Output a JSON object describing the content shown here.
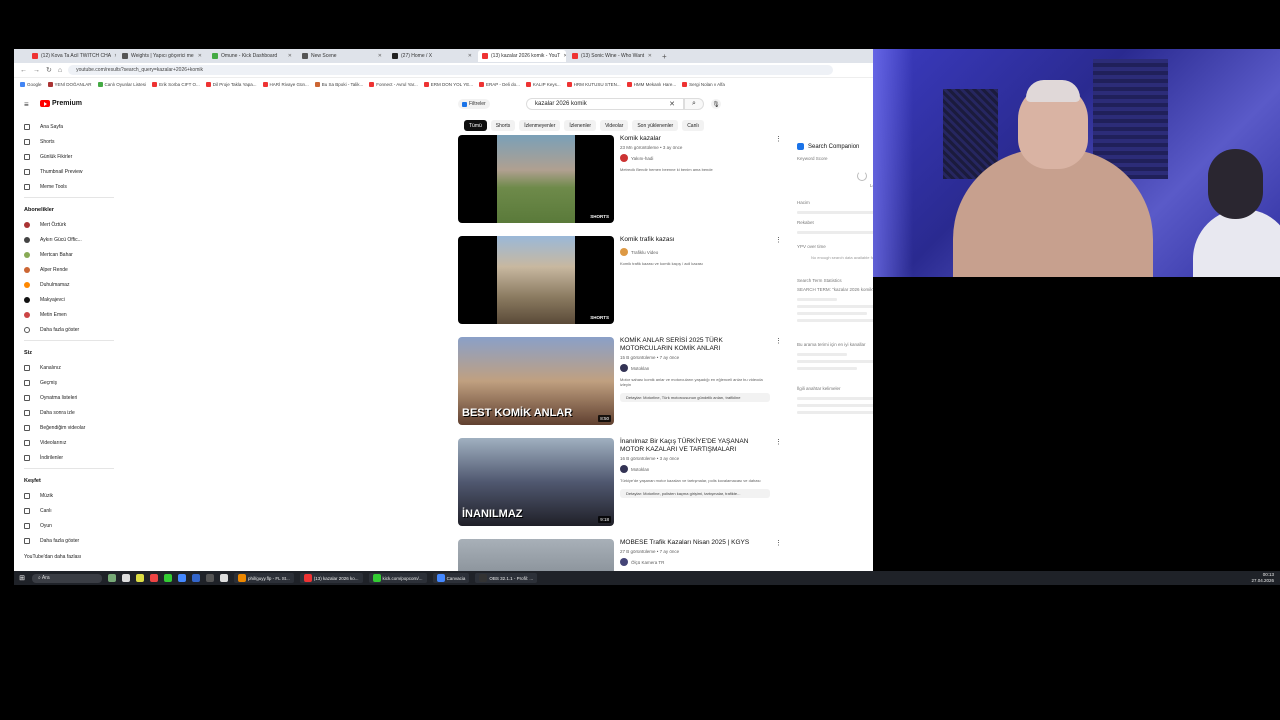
{
  "browser": {
    "tabs": [
      {
        "label": "(12) Kova Ta Acil TWITCH CHA",
        "color": "#e33"
      },
      {
        "label": "Weights | Yapıcı göçerici me",
        "color": "#555"
      },
      {
        "label": "Omune - Kick Dashboard",
        "color": "#4a4"
      },
      {
        "label": "New Scene",
        "color": "#555"
      },
      {
        "label": "(27) Home / X",
        "color": "#222"
      },
      {
        "label": "(13) kazalar 2026 komik - YouT",
        "color": "#e33",
        "active": true
      },
      {
        "label": "(13) Sonic Wine - Who Want",
        "color": "#e33"
      }
    ],
    "url": "youtube.com/results?search_query=kazalar+2026+komik",
    "bookmarks": [
      "Google",
      "YENİ DOĞANLAR",
      "Canlı Oyunlar Listesi",
      "Erik Sorba CIFT O...",
      "Dil Proje Takla Yapa...",
      "HARİ Rivaye Gün...",
      "Bu Sa Bpoki - Talik...",
      "Fonnect - Avrul Yar...",
      "ERM DON YOL YE...",
      "ERAP - Deli do...",
      "KALIP Keys...",
      "HRM KUTUSU STEN...",
      "HMM Mekanlı Hare...",
      "Sergi Nolan v Alfa"
    ]
  },
  "youtube": {
    "logo": "Premium",
    "filters_label": "Filtreler",
    "search_query": "kazalar 2026 komik",
    "sidebar": {
      "main": [
        "Ana Sayfa",
        "Shorts",
        "Günlük Fikirler",
        "Thumbnail Preview",
        "Meme Tools"
      ],
      "subs_heading": "Abonelikler",
      "subs": [
        {
          "name": "Mert Öztürk",
          "color": "#a33"
        },
        {
          "name": "Aykırı Gücü Offic...",
          "color": "#444"
        },
        {
          "name": "Mertcan Bahar",
          "color": "#8a5"
        },
        {
          "name": "Alper Rende",
          "color": "#c63"
        },
        {
          "name": "Duhulmamaz",
          "color": "#f80"
        },
        {
          "name": "Makyajevci",
          "color": "#111"
        },
        {
          "name": "Metin Emen",
          "color": "#c44"
        },
        {
          "name": "Daha fazla göster",
          "color": "#fff"
        }
      ],
      "you_heading": "Siz",
      "you": [
        "Kanalınız",
        "Geçmiş",
        "Oynatma listeleri",
        "Daha sonra izle",
        "Beğendiğim videolar",
        "Videolarınız",
        "İndirilenler"
      ],
      "explore_heading": "Keşfet",
      "explore": [
        "Müzik",
        "Canlı",
        "Oyun",
        "Daha fazla göster"
      ],
      "footer": "YouTube'dan daha fazlası"
    },
    "chips": [
      "Tümü",
      "Shorts",
      "İzlenmeyenler",
      "İzlenenler",
      "Videolar",
      "Son yüklenenler",
      "Canlı"
    ],
    "results": [
      {
        "title": "Komik kazalar",
        "meta": "23 Mn görüntüleme • 3 ay önce",
        "channel": "Yakını-hadi",
        "desc": "Metrecik Bendir hemen beenne ki benim ama bende",
        "chapters": "",
        "badge": "SHORTS",
        "overlay": ""
      },
      {
        "title": "Komik trafik kazası",
        "meta": "",
        "channel": "Trafiklu Video",
        "desc": "Komik trafik kazası ve komik kaçış / acil kazası",
        "chapters": "",
        "badge": "SHORTS",
        "overlay": ""
      },
      {
        "title": "KOMİK ANLAR SERİSİ 2025 TÜRK MOTORCULARIN KOMİK ANLARI",
        "meta": "15 B görüntüleme • 7 ay önce",
        "channel": "Motoklan",
        "desc": "Motor sahası komik anlar ve motorcuların yaşadığı en eğlenceli anlar bu videoda izleyin",
        "chapters": "Detaylar: Motorline, Türk motorcusunun gündelik anları, trafikline",
        "badge": "8:50",
        "overlay": "BEST KOMİK ANLAR"
      },
      {
        "title": "İnanılmaz Bir Kaçış TÜRKİYE'DE YAŞANAN MOTOR KAZALARI VE TARTIŞMALARI",
        "meta": "16 B görüntüleme • 3 ay önce",
        "channel": "Motoklan",
        "desc": "Türkiye'de yaşanan motor kazaları ve tartışmalar, polis kovalamacası ve dahası",
        "chapters": "Detaylar: Motorline, polisten kaçma girişimi, tartışmalar, trafikte...",
        "badge": "9:18",
        "overlay": "İNANILMAZ"
      },
      {
        "title": "MOBESE Trafik Kazaları Nisan 2025 | KGYS",
        "meta": "27 B görüntüleme • 7 ay önce",
        "channel": "Ölçü Kamera TR",
        "desc": "",
        "chapters": "",
        "badge": "",
        "overlay": ""
      }
    ]
  },
  "companion": {
    "title": "Search Companion",
    "keyword_score": "Keyword Score",
    "loading": "Loading data",
    "rows": [
      "Hacim",
      "Rekabet",
      "YPV over time"
    ],
    "no_data": "No enough search data available for this keyword",
    "top_videos_heading": "Search Term Statistics",
    "top_videos_query": "SEARCH TERM: \"kazalar 2026 komik\"",
    "similar_heading": "Bu arama terimi için en iyi kanallar",
    "related_heading": "İlgili anahtar kelimeler"
  },
  "taskbar": {
    "search": "Ara",
    "apps": [
      "phil/guyy.flp - FL St...",
      "(13) kazalar 2026 ko...",
      "kick.com/popcorn/...",
      "Canvacia",
      "OBS 32.1.1 - Profil: ..."
    ],
    "time": "00:13",
    "date": "27.04.2026"
  }
}
